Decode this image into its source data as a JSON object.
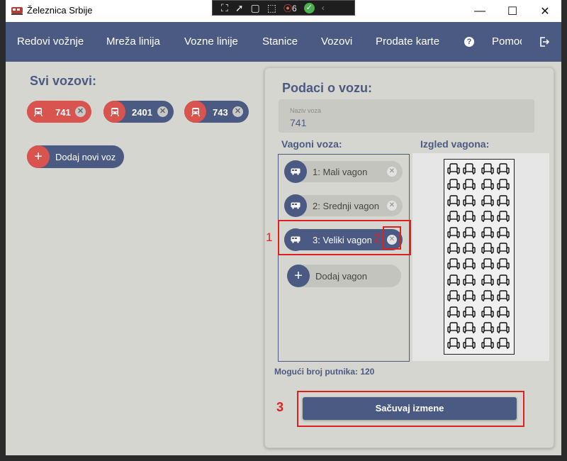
{
  "titlebar": {
    "title": "Železnica Srbije",
    "debug_count": "6"
  },
  "nav": {
    "items": [
      "Redovi vožnje",
      "Mreža linija",
      "Vozne linije",
      "Stanice",
      "Vozovi",
      "Prodate karte",
      "Pomoć"
    ]
  },
  "trains": {
    "heading": "Svi vozovi:",
    "items": [
      {
        "label": "741",
        "selected": true
      },
      {
        "label": "2401",
        "selected": false
      },
      {
        "label": "743",
        "selected": false
      }
    ],
    "add_label": "Dodaj novi voz"
  },
  "details": {
    "heading": "Podaci o vozu:",
    "name_placeholder": "Naziv voza",
    "name_value": "741",
    "wagons_heading": "Vagoni voza:",
    "layout_heading": "Izgled vagona:",
    "wagons": [
      {
        "label": "1: Mali vagon",
        "selected": false
      },
      {
        "label": "2: Srednji vagon",
        "selected": false
      },
      {
        "label": "3: Veliki vagon",
        "selected": true
      }
    ],
    "add_wagon_label": "Dodaj vagon",
    "capacity": "Mogući broj putnika: 120",
    "save_label": "Sačuvaj izmene"
  },
  "annotations": [
    "1",
    "2",
    "3"
  ],
  "colors": {
    "primary": "#4a5a82",
    "accent": "#d9534f",
    "highlight": "#e02020"
  },
  "seat_layout": {
    "rows": 12,
    "left_seats": 2,
    "right_seats": 2
  }
}
